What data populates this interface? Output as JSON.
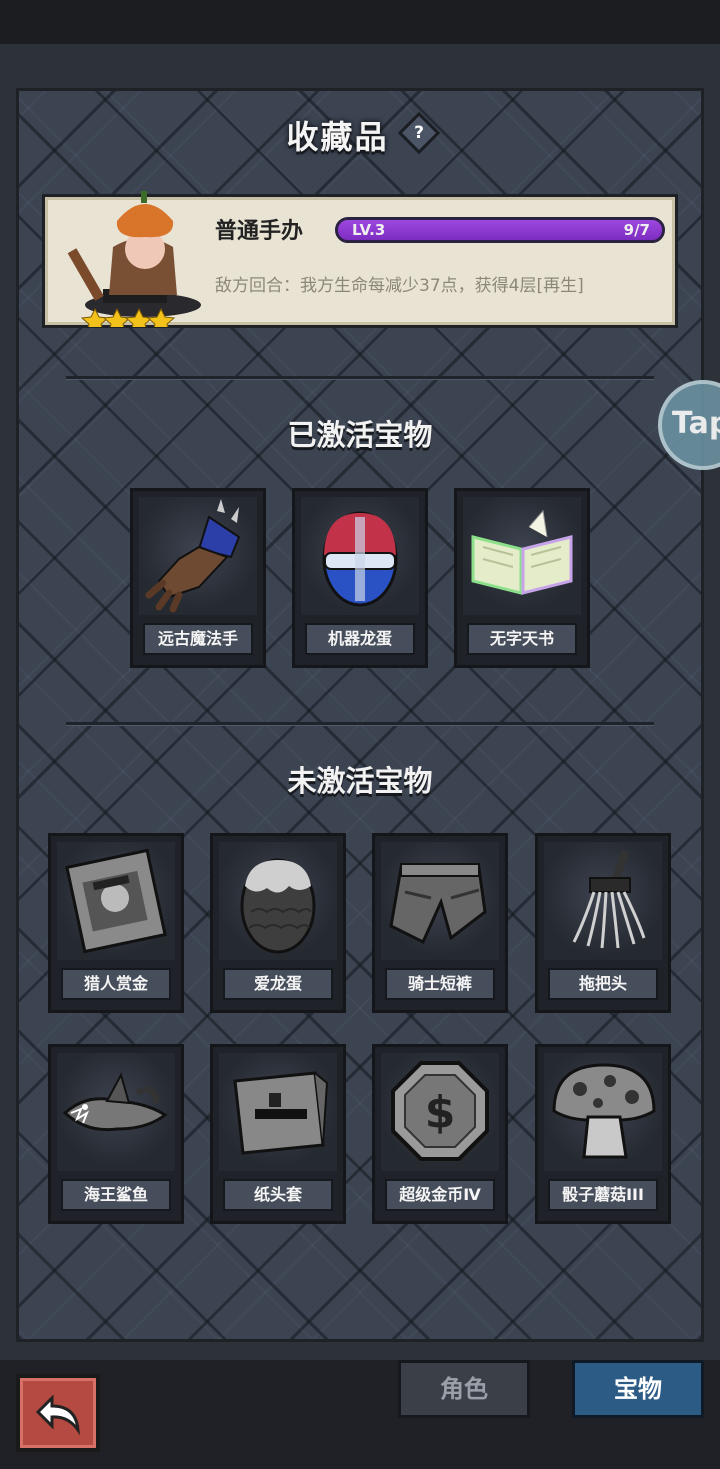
{
  "header": {
    "title": "收藏品",
    "help_label": "?"
  },
  "figure": {
    "name": "普通手办",
    "level": "LV.3",
    "count": "9/7",
    "progress": 1.0,
    "stars": 4,
    "description": "敌方回合：我方生命每减少37点，获得4层[再生]"
  },
  "active": {
    "title": "已激活宝物",
    "items": [
      {
        "name": "远古魔法手",
        "icon": "gauntlet-icon"
      },
      {
        "name": "机器龙蛋",
        "icon": "robot-egg-icon"
      },
      {
        "name": "无字天书",
        "icon": "book-icon"
      }
    ]
  },
  "inactive": {
    "title": "未激活宝物",
    "items": [
      {
        "name": "猎人赏金",
        "icon": "wanted-poster-icon"
      },
      {
        "name": "爱龙蛋",
        "icon": "egg-icon"
      },
      {
        "name": "骑士短裤",
        "icon": "shorts-icon"
      },
      {
        "name": "拖把头",
        "icon": "mop-icon"
      },
      {
        "name": "海王鲨鱼",
        "icon": "shark-icon"
      },
      {
        "name": "纸头套",
        "icon": "paper-bag-icon"
      },
      {
        "name": "超级金币Ⅳ",
        "icon": "coin-icon"
      },
      {
        "name": "骰子蘑菇III",
        "icon": "mushroom-icon"
      }
    ]
  },
  "floating": {
    "label": "Tap"
  },
  "tabs": {
    "role": "角色",
    "treasure": "宝物"
  },
  "colors": {
    "accent_purple": "#8a36c9",
    "selected_tab": "#2c5c86",
    "back_button": "#b44a41"
  }
}
